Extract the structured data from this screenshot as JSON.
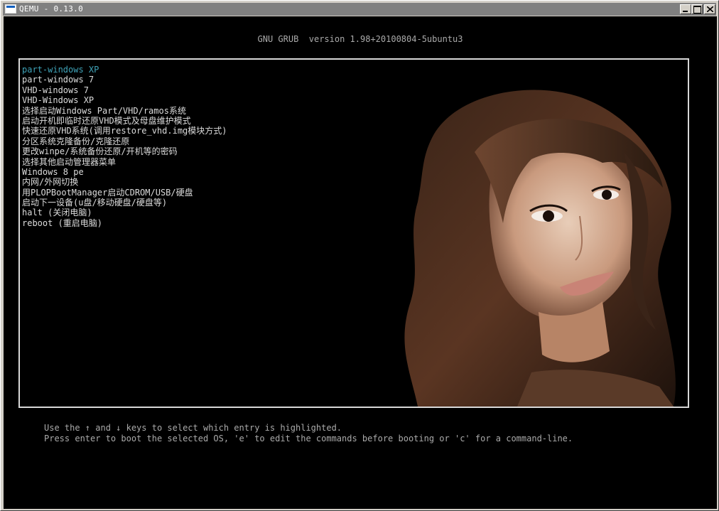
{
  "window": {
    "title": "QEMU - 0.13.0"
  },
  "grub": {
    "header": "GNU GRUB  version 1.98+20100804-5ubuntu3",
    "selected_index": 0,
    "menu_items": [
      "part-windows XP",
      "part-windows 7",
      "VHD-windows 7",
      "VHD-Windows XP",
      "选择启动Windows Part/VHD/ramos系统",
      "启动开机即临时还原VHD模式及母盘维护模式",
      "快速还原VHD系统(调用restore_vhd.img模块方式)",
      "分区系统克隆备份/克隆还原",
      "更改winpe/系统备份还原/开机等的密码",
      "选择其他启动管理器菜单",
      "Windows 8 pe",
      "内网/外网切换",
      "用PLOPBootManager启动CDROM/USB/硬盘",
      "启动下一设备(u盘/移动硬盘/硬盘等)",
      "halt (关闭电脑)",
      "reboot (重启电脑)"
    ],
    "help_line1": "Use the ↑ and ↓ keys to select which entry is highlighted.",
    "help_line2": "Press enter to boot the selected OS, 'e' to edit the commands before booting or 'c' for a command-line."
  },
  "colors": {
    "titlebar": "#808080",
    "screen_bg": "#000000",
    "menu_text": "#dcdcdc",
    "highlight_text": "#3fa3b8",
    "border": "#d8d8d8"
  }
}
